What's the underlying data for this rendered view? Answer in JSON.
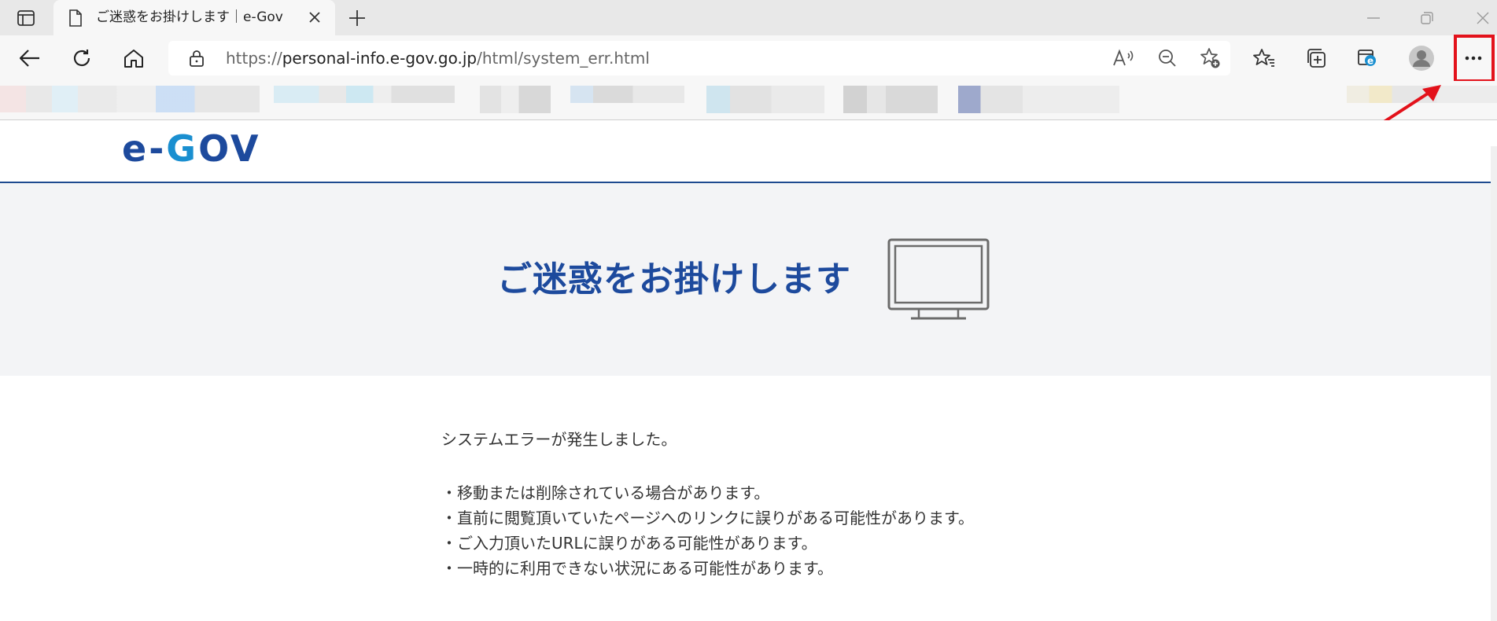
{
  "browser": {
    "tab_title": "ご迷惑をお掛けします｜e-Gov",
    "url_scheme": "https://",
    "url_host": "personal-info.e-gov.go.jp",
    "url_path": "/html/system_err.html"
  },
  "page": {
    "logo_text": "e-GOV",
    "hero_title": "ご迷惑をお掛けします",
    "lead": "システムエラーが発生しました。",
    "bullets": [
      "・移動または削除されている場合があります。",
      "・直前に閲覧頂いていたページへのリンクに誤りがある可能性があります。",
      "・ご入力頂いたURLに誤りがある可能性があります。",
      "・一時的に利用できない状況にある可能性があります。"
    ]
  },
  "colors": {
    "brand_blue": "#1d4a9d",
    "logo_accent": "#1a8fd0",
    "annotation_red": "#e3121b"
  },
  "icons": [
    "tab-actions-icon",
    "page-icon",
    "close-icon",
    "plus-icon",
    "minimize-icon",
    "restore-icon",
    "back-icon",
    "refresh-icon",
    "home-icon",
    "lock-icon",
    "read-aloud-icon",
    "zoom-out-icon",
    "add-favorite-icon",
    "favorites-icon",
    "collections-icon",
    "ie-mode-icon",
    "profile-icon",
    "more-icon",
    "monitor-icon"
  ]
}
